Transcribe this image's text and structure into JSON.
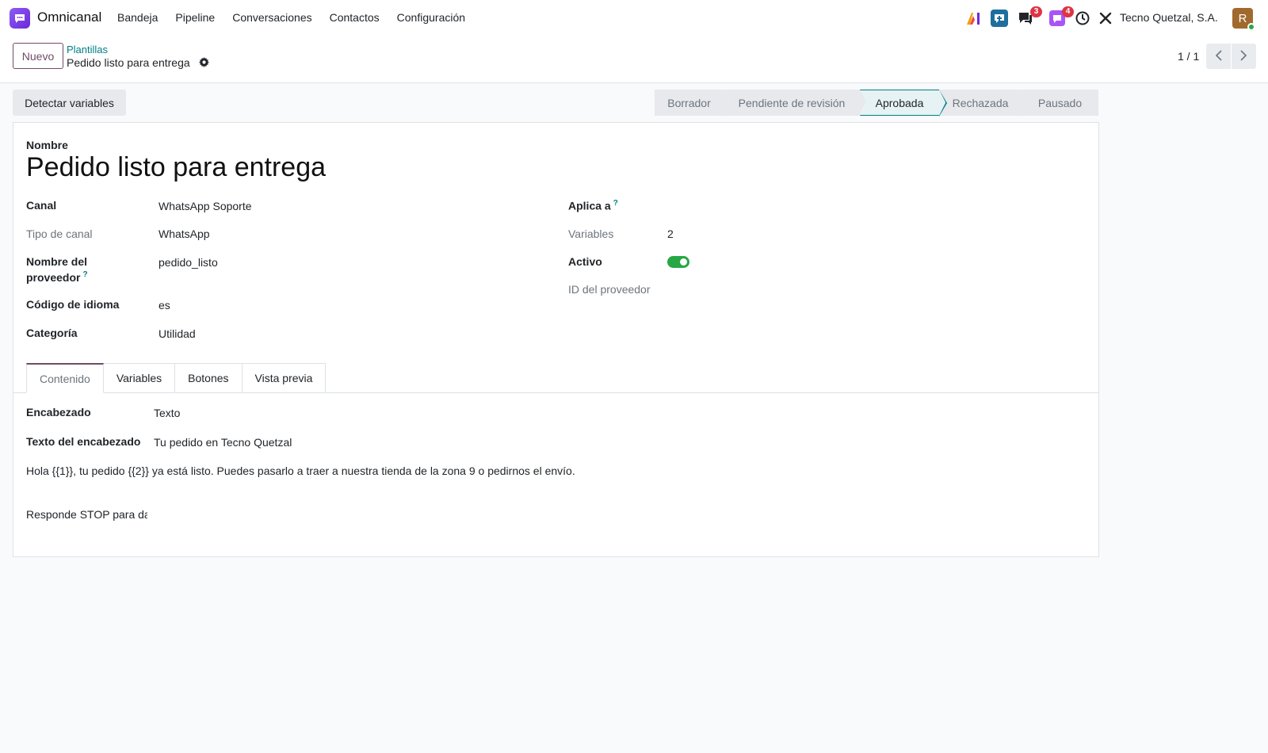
{
  "navbar": {
    "app_name": "Omnicanal",
    "menu": [
      "Bandeja",
      "Pipeline",
      "Conversaciones",
      "Contactos",
      "Configuración"
    ],
    "systray": {
      "messages_badge": "3",
      "activity_badge": "4",
      "company": "Tecno Quetzal, S.A.",
      "avatar_initial": "R"
    }
  },
  "control_panel": {
    "new_button": "Nuevo",
    "breadcrumb": "Plantillas",
    "record_title": "Pedido listo para entrega",
    "pager": "1 / 1"
  },
  "actions": {
    "detect_variables": "Detectar variables"
  },
  "statusbar": {
    "stages": [
      "Borrador",
      "Pendiente de revisión",
      "Aprobada",
      "Rechazada",
      "Pausado"
    ],
    "active": "Aprobada"
  },
  "form": {
    "name_label": "Nombre",
    "name_value": "Pedido listo para entrega",
    "left": {
      "canal_label": "Canal",
      "canal_value": "WhatsApp Soporte",
      "tipo_canal_label": "Tipo de canal",
      "tipo_canal_value": "WhatsApp",
      "nombre_proveedor_label_1": "Nombre del",
      "nombre_proveedor_label_2": "proveedor",
      "nombre_proveedor_value": "pedido_listo",
      "codigo_idioma_label": "Código de idioma",
      "codigo_idioma_value": "es",
      "categoria_label": "Categoría",
      "categoria_value": "Utilidad"
    },
    "right": {
      "aplica_label": "Aplica a",
      "variables_label": "Variables",
      "variables_value": "2",
      "activo_label": "Activo",
      "activo_value": true,
      "id_proveedor_label": "ID del proveedor"
    },
    "help_mark": "?"
  },
  "tabs": {
    "items": [
      "Contenido",
      "Variables",
      "Botones",
      "Vista previa"
    ],
    "active": "Contenido"
  },
  "content": {
    "encabezado_label": "Encabezado",
    "encabezado_value": "Texto",
    "texto_encabezado_label": "Texto del encabezado",
    "texto_encabezado_value": "Tu pedido en Tecno Quetzal",
    "body": "Hola {{1}}, tu pedido {{2}} ya está listo. Puedes pasarlo a traer a nuestra tienda de la zona 9 o pedirnos el envío.",
    "footer": "Responde STOP para darte de baja."
  },
  "colors": {
    "brand": "#714b67",
    "accent": "#017e84",
    "toggle_on": "#28a745",
    "badge": "#dc3545"
  }
}
